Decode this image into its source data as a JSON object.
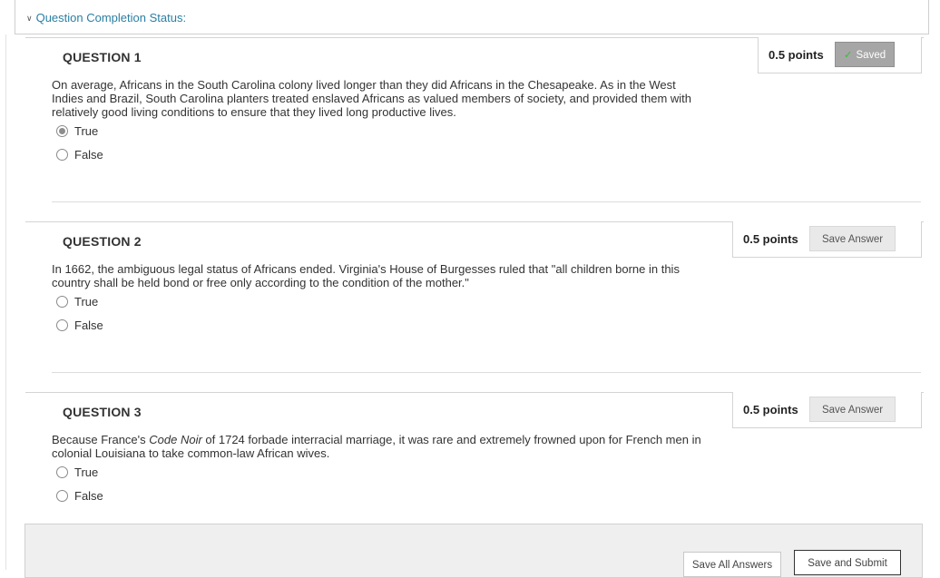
{
  "status": {
    "label": "Question Completion Status:"
  },
  "questions": [
    {
      "title": "QUESTION 1",
      "points": "0.5 points",
      "button": "Saved",
      "text": "On average, Africans in the South Carolina colony lived longer than they did Africans in the Chesapeake.  As in the West Indies and Brazil, South Carolina planters treated enslaved Africans as valued members of society, and provided them with relatively good living conditions to ensure that they lived long productive lives.",
      "options": [
        "True",
        "False"
      ],
      "selected": "True"
    },
    {
      "title": "QUESTION 2",
      "points": "0.5 points",
      "button": "Save Answer",
      "text": "In 1662, the ambiguous legal status of Africans ended. Virginia's House of Burgesses ruled that \"all children borne in this country shall be held bond or free only according to the condition of the mother.\"",
      "options": [
        "True",
        "False"
      ],
      "selected": null
    },
    {
      "title": "QUESTION 3",
      "points": "0.5 points",
      "button": "Save Answer",
      "text_before": "Because France's ",
      "text_italic": "Code Noir",
      "text_after": " of 1724 forbade interracial marriage, it was rare and extremely frowned upon for French men in colonial Louisiana to take common-law African wives.",
      "options": [
        "True",
        "False"
      ],
      "selected": null
    }
  ],
  "footer": {
    "save_all": "Save All Answers",
    "save_submit": "Save and Submit"
  }
}
